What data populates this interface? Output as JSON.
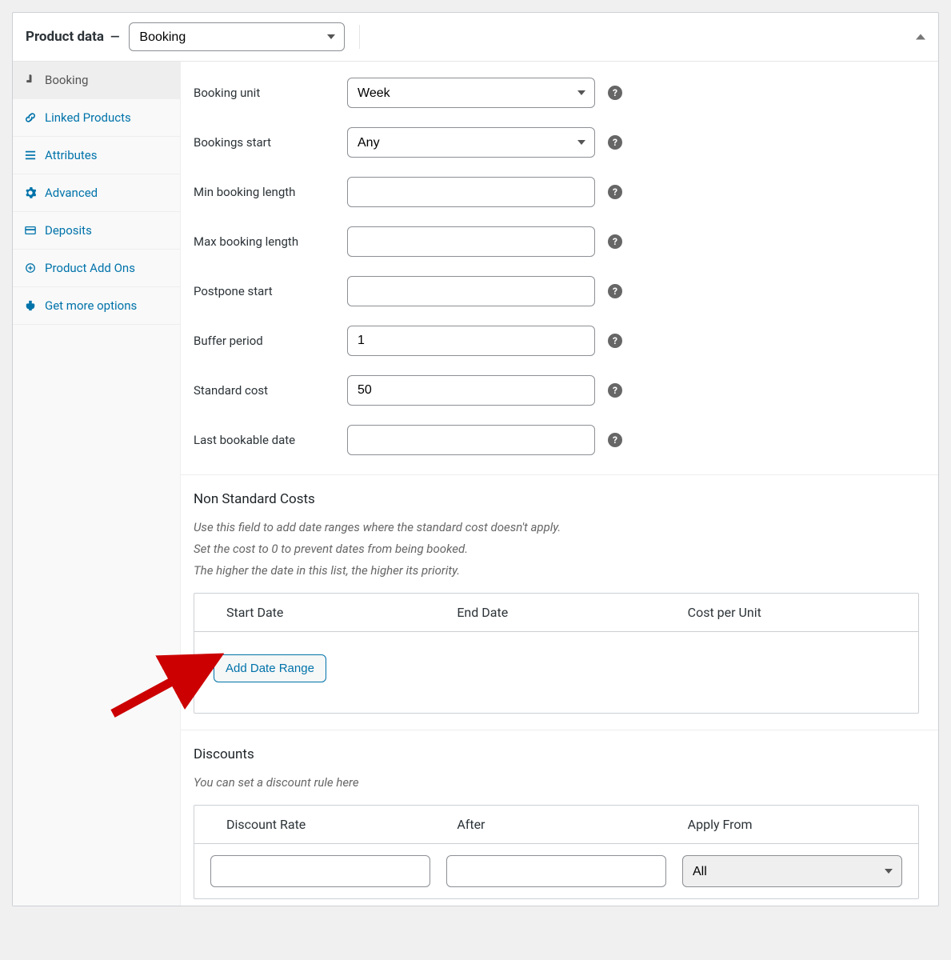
{
  "header": {
    "title": "Product data",
    "product_type": "Booking"
  },
  "sidebar": {
    "items": [
      {
        "label": "Booking"
      },
      {
        "label": "Linked Products"
      },
      {
        "label": "Attributes"
      },
      {
        "label": "Advanced"
      },
      {
        "label": "Deposits"
      },
      {
        "label": "Product Add Ons"
      },
      {
        "label": "Get more options"
      }
    ]
  },
  "form": {
    "booking_unit": {
      "label": "Booking unit",
      "value": "Week"
    },
    "bookings_start": {
      "label": "Bookings start",
      "value": "Any"
    },
    "min_booking_length": {
      "label": "Min booking length",
      "value": ""
    },
    "max_booking_length": {
      "label": "Max booking length",
      "value": ""
    },
    "postpone_start": {
      "label": "Postpone start",
      "value": ""
    },
    "buffer_period": {
      "label": "Buffer period",
      "value": "1"
    },
    "standard_cost": {
      "label": "Standard cost",
      "value": "50"
    },
    "last_bookable_date": {
      "label": "Last bookable date",
      "value": ""
    }
  },
  "non_standard_costs": {
    "title": "Non Standard Costs",
    "desc1": "Use this field to add date ranges where the standard cost doesn't apply.",
    "desc2": "Set the cost to 0 to prevent dates from being booked.",
    "desc3": "The higher the date in this list, the higher its priority.",
    "columns": {
      "c1": "Start Date",
      "c2": "End Date",
      "c3": "Cost per Unit"
    },
    "button": "Add Date Range"
  },
  "discounts": {
    "title": "Discounts",
    "desc": "You can set a discount rule here",
    "columns": {
      "c1": "Discount Rate",
      "c2": "After",
      "c3": "Apply From"
    },
    "row": {
      "discount_rate": "",
      "after": "",
      "apply_from": "All"
    }
  }
}
